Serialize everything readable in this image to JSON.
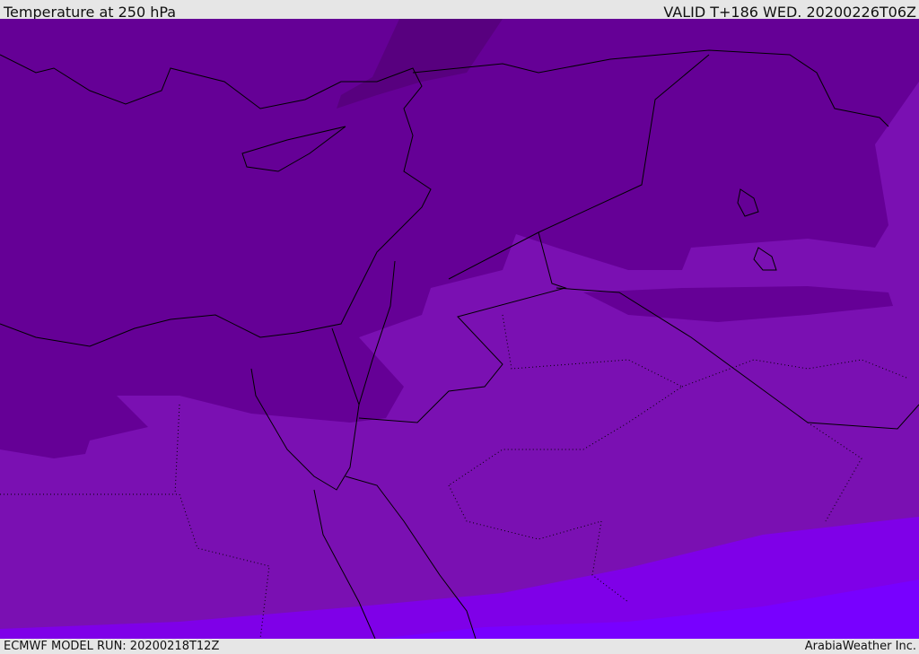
{
  "header": {
    "title": "Temperature at 250 hPa",
    "valid": "VALID T+186 WED. 20200226T06Z"
  },
  "footer": {
    "model_run": "ECMWF MODEL RUN: 20200218T12Z",
    "credit": "ArabiaWeather Inc."
  },
  "colors": {
    "band_darkest": "#58007f",
    "band_dark": "#650096",
    "band_mid": "#7a10b2",
    "band_light": "#7f00e8",
    "band_lightest": "#7800ff",
    "coastline": "#000000"
  }
}
